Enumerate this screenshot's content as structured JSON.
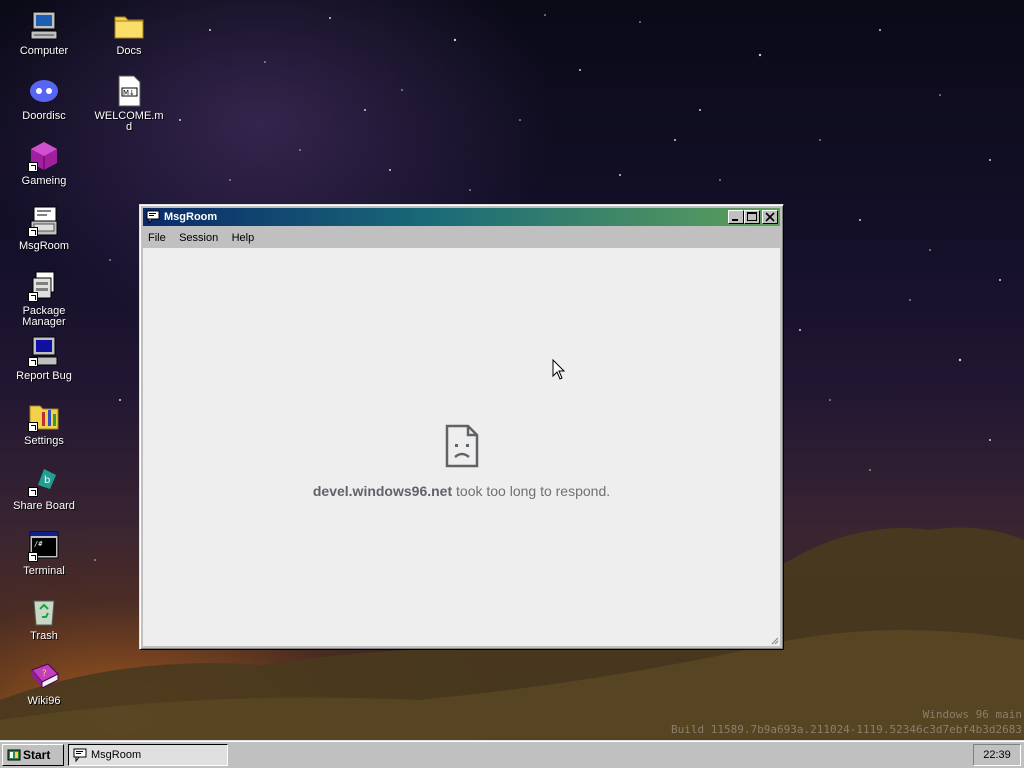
{
  "desktop": {
    "icons": [
      {
        "label": "Computer",
        "icon": "computer-icon"
      },
      {
        "label": "Docs",
        "icon": "folder-icon"
      },
      {
        "label": "Doordisc",
        "icon": "doordisc-icon"
      },
      {
        "label": "WELCOME.md",
        "icon": "markdown-file-icon"
      },
      {
        "label": "Gameing",
        "icon": "game-cube-icon"
      },
      {
        "label": "MsgRoom",
        "icon": "msgroom-icon"
      },
      {
        "label": "Package Manager",
        "icon": "package-manager-icon"
      },
      {
        "label": "Report Bug",
        "icon": "report-bug-icon"
      },
      {
        "label": "Settings",
        "icon": "settings-icon"
      },
      {
        "label": "Share Board",
        "icon": "share-board-icon"
      },
      {
        "label": "Terminal",
        "icon": "terminal-icon"
      },
      {
        "label": "Trash",
        "icon": "trash-icon"
      },
      {
        "label": "Wiki96",
        "icon": "wiki-book-icon"
      }
    ]
  },
  "window": {
    "title": "MsgRoom",
    "menu": [
      "File",
      "Session",
      "Help"
    ],
    "error": {
      "host": "devel.windows96.net",
      "message": "took too long to respond."
    }
  },
  "watermark": {
    "line1": "Windows 96 main",
    "line2": "Build 11589.7b9a693a.211024-1119.52346c3d7ebf4b3d2683"
  },
  "taskbar": {
    "start_label": "Start",
    "tasks": [
      {
        "label": "MsgRoom"
      }
    ],
    "clock": "22:39"
  },
  "colors": {
    "title_gradient_start": "#0a2a6a",
    "title_gradient_end": "#5ea05a",
    "window_face": "#c0c0c0",
    "content_bg": "#eeeeee"
  }
}
